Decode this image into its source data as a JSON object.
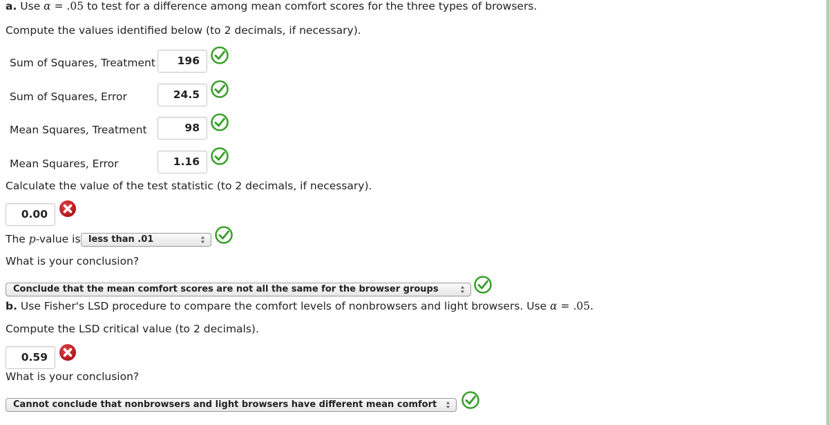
{
  "part_a": {
    "label": "a.",
    "intro_pre": " Use ",
    "alpha_symbol": "α",
    "alpha_eq": " = .05",
    "intro_post": " to test for a difference among mean comfort scores for the three types of browsers.",
    "compute_instruction": "Compute the values identified below (to 2 decimals, if necessary).",
    "fields": [
      {
        "label": "Sum of Squares, Treatment",
        "value": "196",
        "status": "correct"
      },
      {
        "label": "Sum of Squares, Error",
        "value": "24.5",
        "status": "correct"
      },
      {
        "label": "Mean Squares, Treatment",
        "value": "98",
        "status": "correct"
      },
      {
        "label": "Mean Squares, Error",
        "value": "1.16",
        "status": "correct"
      }
    ],
    "test_statistic_instruction": "Calculate the value of the test statistic (to 2 decimals, if necessary).",
    "test_statistic": {
      "value": "0.00",
      "status": "incorrect"
    },
    "pvalue_prefix": "The ",
    "pvalue_p": "p",
    "pvalue_suffix": "-value is",
    "pvalue_select": {
      "selected": "less than .01",
      "status": "correct"
    },
    "conclusion_question": "What is your conclusion?",
    "conclusion_select": {
      "selected": "Conclude that the mean comfort scores are not all the same for the browser groups",
      "status": "correct"
    }
  },
  "part_b": {
    "label": "b.",
    "intro": " Use Fisher's LSD procedure to compare the comfort levels of nonbrowsers and light browsers. Use ",
    "alpha_symbol": "α",
    "alpha_eq": " = .05.",
    "lsd_instruction": "Compute the LSD critical value (to 2 decimals).",
    "lsd_value": {
      "value": "0.59",
      "status": "incorrect"
    },
    "conclusion_question": "What is your conclusion?",
    "conclusion_select": {
      "selected": "Cannot conclude that nonbrowsers and light browsers have different mean comfort scores",
      "status": "correct"
    }
  },
  "colors": {
    "correct_green": "#3aa02c",
    "incorrect_red": "#c0171d",
    "scrollbar_green": "#a8d49a"
  }
}
